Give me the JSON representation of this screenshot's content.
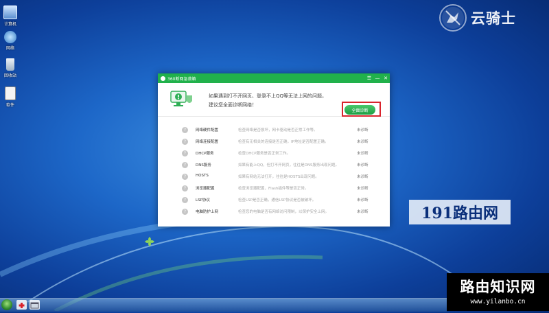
{
  "desktop": {
    "icons": [
      {
        "label": "计算机",
        "icon": "computer-icon"
      },
      {
        "label": "网络",
        "icon": "network-icon"
      },
      {
        "label": "回收站",
        "icon": "recycle-bin-icon"
      },
      {
        "label": "软件",
        "icon": "software-icon"
      }
    ]
  },
  "watermarks": {
    "top_right": "云骑士",
    "middle_right": "191路由网",
    "corner_title": "路由知识网",
    "corner_url": "www.yilanbo.cn"
  },
  "dialog": {
    "title": "360断网急救箱",
    "controls": {
      "menu": "☰",
      "minimize": "—",
      "close": "✕"
    },
    "message_line1": "如果遇到打不开网页、登录不上QQ等无法上网的问题，",
    "message_line2": "建议您全面诊断网络！",
    "diagnose_button": "全面诊断",
    "items": [
      {
        "name": "网络硬件配置",
        "desc": "检查网络是否损坏，网卡驱动是否正常工作等。",
        "status": "未诊断"
      },
      {
        "name": "网络连接配置",
        "desc": "检查有无相关的连接是否正确，IP地址是否配置正确。",
        "status": "未诊断"
      },
      {
        "name": "DHCP服务",
        "desc": "检查DHCP服务是否正常工作。",
        "status": "未诊断"
      },
      {
        "name": "DNS服务",
        "desc": "如果有能上QQ，但打不开网页，往往是DNS服务出现问题。",
        "status": "未诊断"
      },
      {
        "name": "HOSTS",
        "desc": "如果有网站无法打开，往往是HOSTS出现问题。",
        "status": "未诊断"
      },
      {
        "name": "浏览器配置",
        "desc": "检查浏览器配置，Flash插件等是否正常。",
        "status": "未诊断"
      },
      {
        "name": "LSP协议",
        "desc": "检查LSP是否正确，通信LSP协议是否被破坏。",
        "status": "未诊断"
      },
      {
        "name": "电脑防护上网",
        "desc": "检查您的电脑是否有网络访问限制，以保护安全上网。",
        "status": "未诊断"
      }
    ]
  },
  "colors": {
    "dialog_accent": "#21b14b",
    "highlight_box": "#d9232d"
  }
}
